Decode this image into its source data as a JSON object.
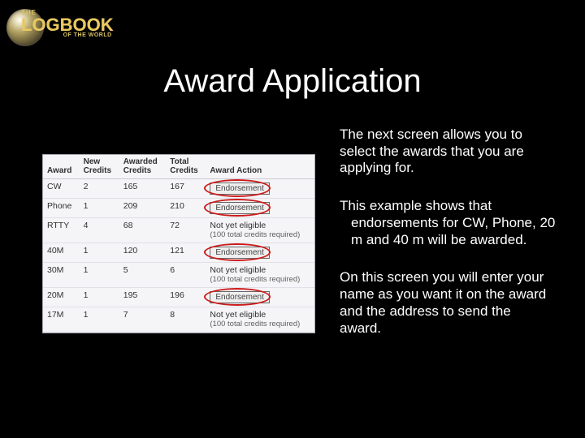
{
  "logo": {
    "the": "THE",
    "main": "LOGBOOK",
    "sub": "OF THE WORLD"
  },
  "title": "Award Application",
  "table": {
    "headers": {
      "award": "Award",
      "new": "New\nCredits",
      "awarded": "Awarded\nCredits",
      "total": "Total\nCredits",
      "action": "Award Action"
    },
    "endorse_label": "Endorsement",
    "not_eligible": "Not yet eligible",
    "note_100": "(100 total credits required)",
    "rows": [
      {
        "award": "CW",
        "new": "2",
        "awarded": "165",
        "total": "167",
        "type": "endorse"
      },
      {
        "award": "Phone",
        "new": "1",
        "awarded": "209",
        "total": "210",
        "type": "endorse"
      },
      {
        "award": "RTTY",
        "new": "4",
        "awarded": "68",
        "total": "72",
        "type": "ineligible"
      },
      {
        "award": "40M",
        "new": "1",
        "awarded": "120",
        "total": "121",
        "type": "endorse"
      },
      {
        "award": "30M",
        "new": "1",
        "awarded": "5",
        "total": "6",
        "type": "ineligible"
      },
      {
        "award": "20M",
        "new": "1",
        "awarded": "195",
        "total": "196",
        "type": "endorse"
      },
      {
        "award": "17M",
        "new": "1",
        "awarded": "7",
        "total": "8",
        "type": "ineligible"
      }
    ]
  },
  "desc": {
    "p1": "The next screen allows you to select the awards that you are applying for.",
    "p2a": "This example shows that",
    "p2b": "endorsements for CW, Phone, 20 m and 40 m will be awarded.",
    "p3": "On this screen you will enter your name as you want it on the award and the address to send the award."
  }
}
